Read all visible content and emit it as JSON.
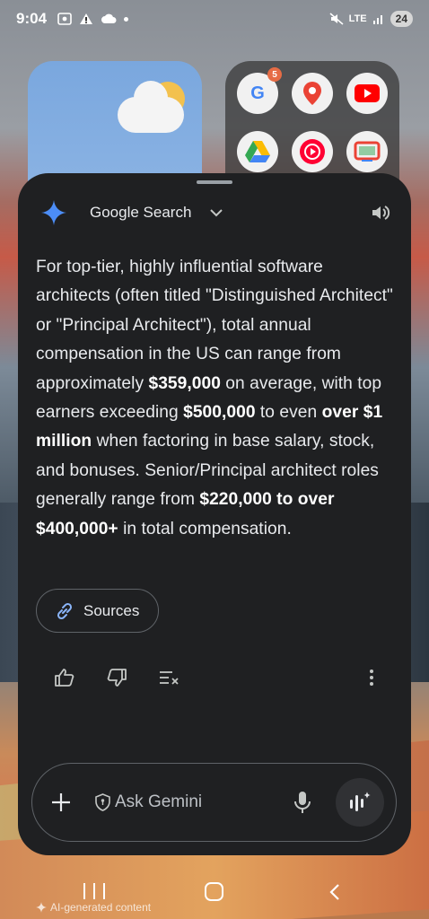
{
  "status_bar": {
    "time": "9:04",
    "network": "LTE",
    "battery": "24"
  },
  "home": {
    "folder_badge": "5"
  },
  "sheet": {
    "title": "Google Search",
    "answer_parts": [
      {
        "text": "For top-tier, highly influential software architects (often titled \"Distinguished Architect\" or \"Principal Architect\"), total annual compensation in the US can range from approximately ",
        "bold": false
      },
      {
        "text": "$359,000",
        "bold": true
      },
      {
        "text": " on average, with top earners exceeding ",
        "bold": false
      },
      {
        "text": "$500,000",
        "bold": true
      },
      {
        "text": " to even ",
        "bold": false
      },
      {
        "text": "over $1 million",
        "bold": true
      },
      {
        "text": " when factoring in base salary, stock, and bonuses. Senior/Principal architect roles generally range from ",
        "bold": false
      },
      {
        "text": "$220,000 to over $400,000+",
        "bold": true
      },
      {
        "text": " in total compensation.",
        "bold": false
      }
    ],
    "sources_label": "Sources",
    "input_placeholder": "Ask Gemini"
  },
  "footer": {
    "ai_label": "AI-generated content"
  },
  "colors": {
    "sheet_bg": "#1f2022",
    "sparkle": "#4c8df6",
    "text": "#e8eaed"
  }
}
